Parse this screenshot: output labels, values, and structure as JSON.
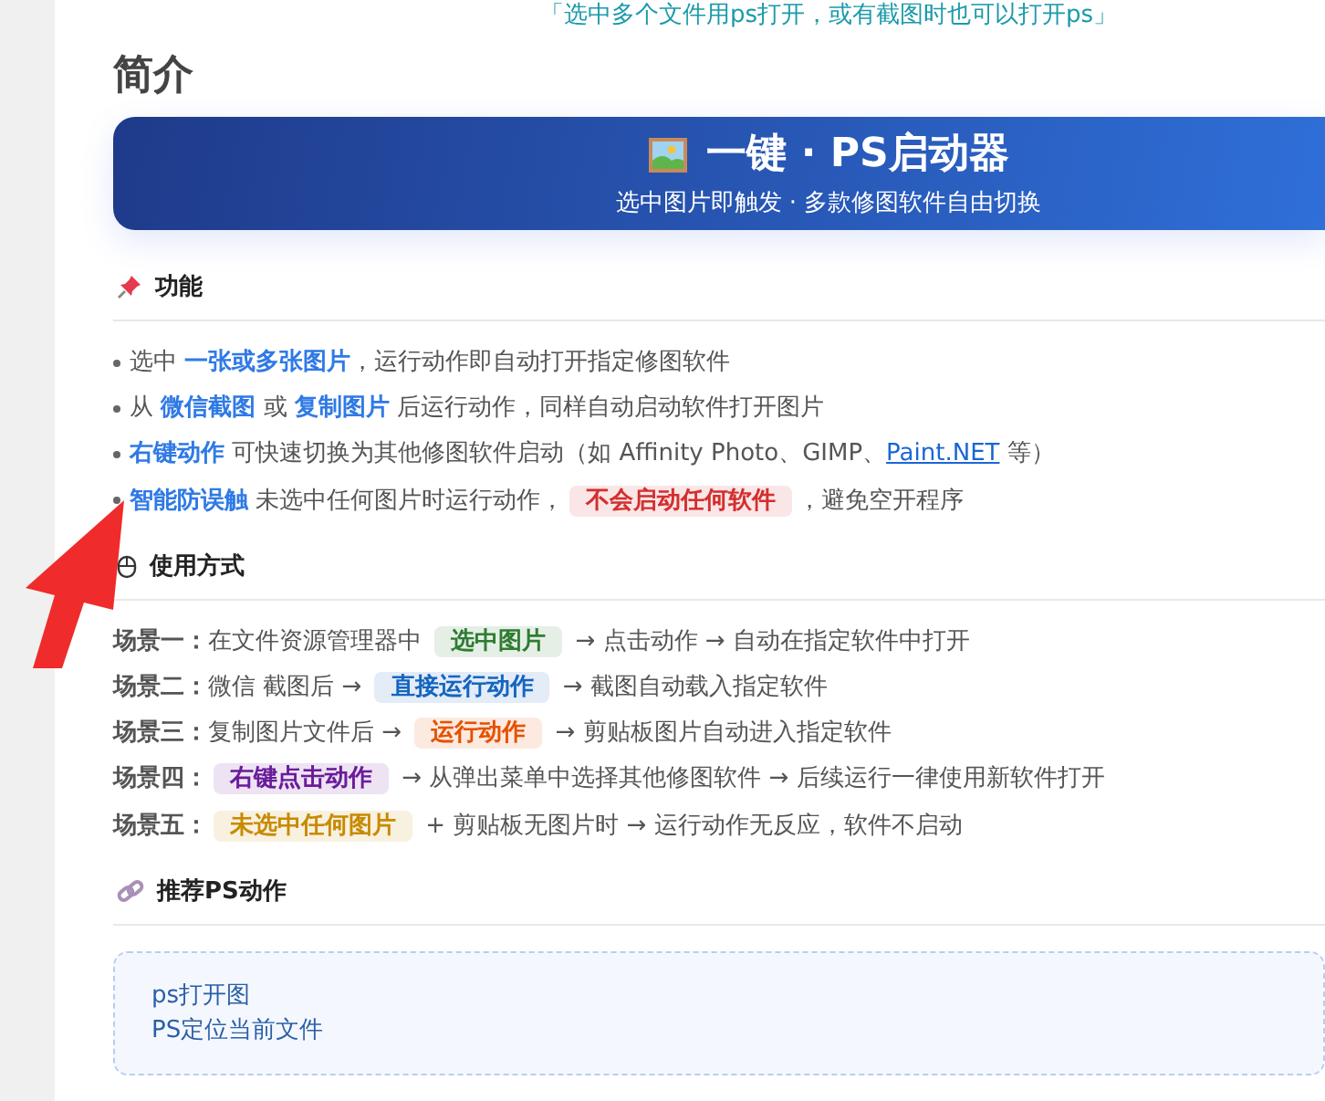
{
  "top_note": "「选中多个文件用ps打开，或有截图时也可以打开ps」",
  "heading": "简介",
  "banner": {
    "title": "一键 · PS启动器",
    "subtitle": "选中图片即触发 · 多款修图软件自由切换"
  },
  "sections": [
    {
      "kind": "bullets",
      "title": "功能",
      "lines": [
        [
          {
            "kind": "text",
            "text": "选中 "
          },
          {
            "kind": "strong",
            "text": "一张或多张图片"
          },
          {
            "kind": "text",
            "text": "，运行动作即自动打开指定修图软件"
          }
        ],
        [
          {
            "kind": "text",
            "text": "从 "
          },
          {
            "kind": "strong",
            "text": "微信截图"
          },
          {
            "kind": "text",
            "text": " 或 "
          },
          {
            "kind": "strong",
            "text": "复制图片"
          },
          {
            "kind": "text",
            "text": " 后运行动作，同样自动启动软件打开图片"
          }
        ],
        [
          {
            "kind": "strong",
            "text": "右键动作"
          },
          {
            "kind": "text",
            "text": " 可快速切换为其他修图软件启动（如 Affinity Photo、GIMP、"
          },
          {
            "kind": "link",
            "text": "Paint.NET"
          },
          {
            "kind": "text",
            "text": " 等）"
          }
        ],
        [
          {
            "kind": "strong",
            "text": "智能防误触"
          },
          {
            "kind": "text",
            "text": " 未选中任何图片时运行动作，"
          },
          {
            "kind": "tag",
            "text": "不会启动任何软件",
            "color": "#d32f2f"
          },
          {
            "kind": "text",
            "text": "，避免空开程序"
          }
        ]
      ]
    },
    {
      "kind": "scenes",
      "title": "使用方式",
      "lines": [
        [
          {
            "kind": "label",
            "text": "场景一："
          },
          {
            "kind": "text",
            "text": "在文件资源管理器中 "
          },
          {
            "kind": "tag",
            "text": "选中图片",
            "color": "#2e7d32"
          },
          {
            "kind": "text",
            "text": " → 点击动作 → 自动在指定软件中打开"
          }
        ],
        [
          {
            "kind": "label",
            "text": "场景二："
          },
          {
            "kind": "text",
            "text": "微信 截图后 → "
          },
          {
            "kind": "tag",
            "text": "直接运行动作",
            "color": "#1565c0"
          },
          {
            "kind": "text",
            "text": " → 截图自动载入指定软件"
          }
        ],
        [
          {
            "kind": "label",
            "text": "场景三："
          },
          {
            "kind": "text",
            "text": "复制图片文件后 → "
          },
          {
            "kind": "tag",
            "text": "运行动作",
            "color": "#e65100"
          },
          {
            "kind": "text",
            "text": " → 剪贴板图片自动进入指定软件"
          }
        ],
        [
          {
            "kind": "label",
            "text": "场景四："
          },
          {
            "kind": "tag",
            "text": "右键点击动作",
            "color": "#6a1b9a"
          },
          {
            "kind": "text",
            "text": " → 从弹出菜单中选择其他修图软件 → 后续运行一律使用新软件打开"
          }
        ],
        [
          {
            "kind": "label",
            "text": "场景五："
          },
          {
            "kind": "tag",
            "text": "未选中任何图片",
            "color": "#c88a00"
          },
          {
            "kind": "text",
            "text": " + 剪贴板无图片时 → 运行动作无反应，软件不启动"
          }
        ]
      ]
    },
    {
      "kind": "links",
      "title": "推荐PS动作",
      "lines": [
        [
          {
            "kind": "text",
            "text": "ps打开图"
          }
        ],
        [
          {
            "kind": "text",
            "text": "PS定位当前文件"
          }
        ]
      ]
    }
  ]
}
